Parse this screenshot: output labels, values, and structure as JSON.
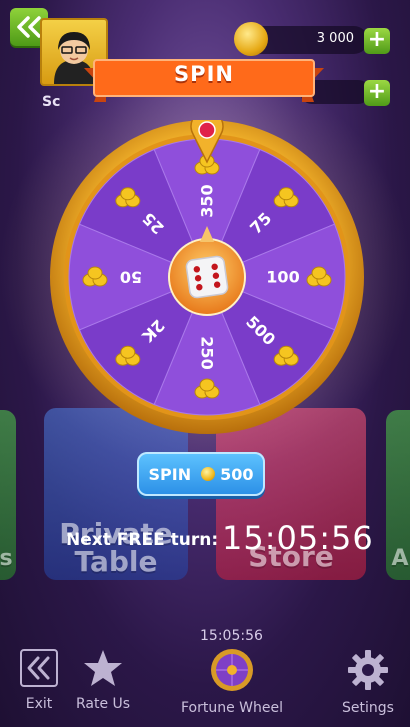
{
  "header": {
    "avatar_name": "Sc",
    "coins": "3 000",
    "plus": "+"
  },
  "ribbon": {
    "title": "SPIN"
  },
  "wheel": {
    "segments": [
      "350",
      "75",
      "100",
      "500",
      "250",
      "2K",
      "50",
      "25"
    ]
  },
  "cards": {
    "left_title_line1": "Private",
    "left_title_line2": "Table",
    "right_title": "Store",
    "left_edge_text": "s",
    "right_edge_text": "A"
  },
  "spin_button": {
    "label": "SPIN",
    "cost": "500"
  },
  "free_turn": {
    "label": "Next FREE turn:",
    "timer": "15:05:56"
  },
  "bottom_timer": "15:05:56",
  "nav": {
    "exit": "Exit",
    "rate": "Rate Us",
    "wheel": "Fortune Wheel",
    "settings": "Setings"
  },
  "colors": {
    "wheel_purple": "#8a4ad6",
    "wheel_gold": "#f2b22b",
    "ribbon_orange": "#ff6a1a",
    "spin_blue": "#3aa6f2"
  }
}
